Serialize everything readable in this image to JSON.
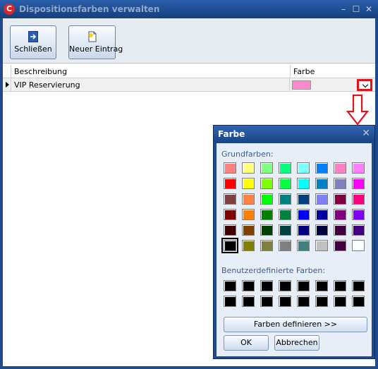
{
  "window": {
    "title": "Dispositionsfarben verwalten",
    "app_icon_glyph": "C"
  },
  "toolbar": {
    "close_label": "Schließen",
    "new_label": "Neuer Eintrag"
  },
  "grid": {
    "headers": [
      "Beschreibung",
      "Farbe"
    ],
    "rows": [
      {
        "description": "VIP Reservierung",
        "color": "#ff88cc"
      }
    ]
  },
  "dialog": {
    "title": "Farbe",
    "close_glyph": "✕",
    "basic_label": "Grundfarben:",
    "custom_label": "Benutzerdefinierte Farben:",
    "define_button": "Farben definieren >>",
    "ok_button": "OK",
    "cancel_button": "Abbrechen",
    "basic_colors": [
      "#ff8080",
      "#ffff80",
      "#80ff80",
      "#00ff80",
      "#80ffff",
      "#0080ff",
      "#ff80c0",
      "#ff80ff",
      "#ff0000",
      "#ffff00",
      "#80ff00",
      "#00ff40",
      "#00ffff",
      "#0080c0",
      "#8080c0",
      "#ff00ff",
      "#804040",
      "#ff8040",
      "#00ff00",
      "#008080",
      "#004080",
      "#8080ff",
      "#800040",
      "#ff0080",
      "#800000",
      "#ff8000",
      "#008000",
      "#008040",
      "#0000ff",
      "#0000a0",
      "#800080",
      "#8000ff",
      "#400000",
      "#804000",
      "#004000",
      "#004040",
      "#000080",
      "#000040",
      "#400040",
      "#400080",
      "#000000",
      "#808000",
      "#808040",
      "#808080",
      "#408080",
      "#c0c0c0",
      "#400040",
      "#ffffff"
    ],
    "selected_index": 40,
    "custom_colors": [
      "#000000",
      "#000000",
      "#000000",
      "#000000",
      "#000000",
      "#000000",
      "#000000",
      "#000000",
      "#000000",
      "#000000",
      "#000000",
      "#000000",
      "#000000",
      "#000000",
      "#000000",
      "#000000"
    ]
  }
}
